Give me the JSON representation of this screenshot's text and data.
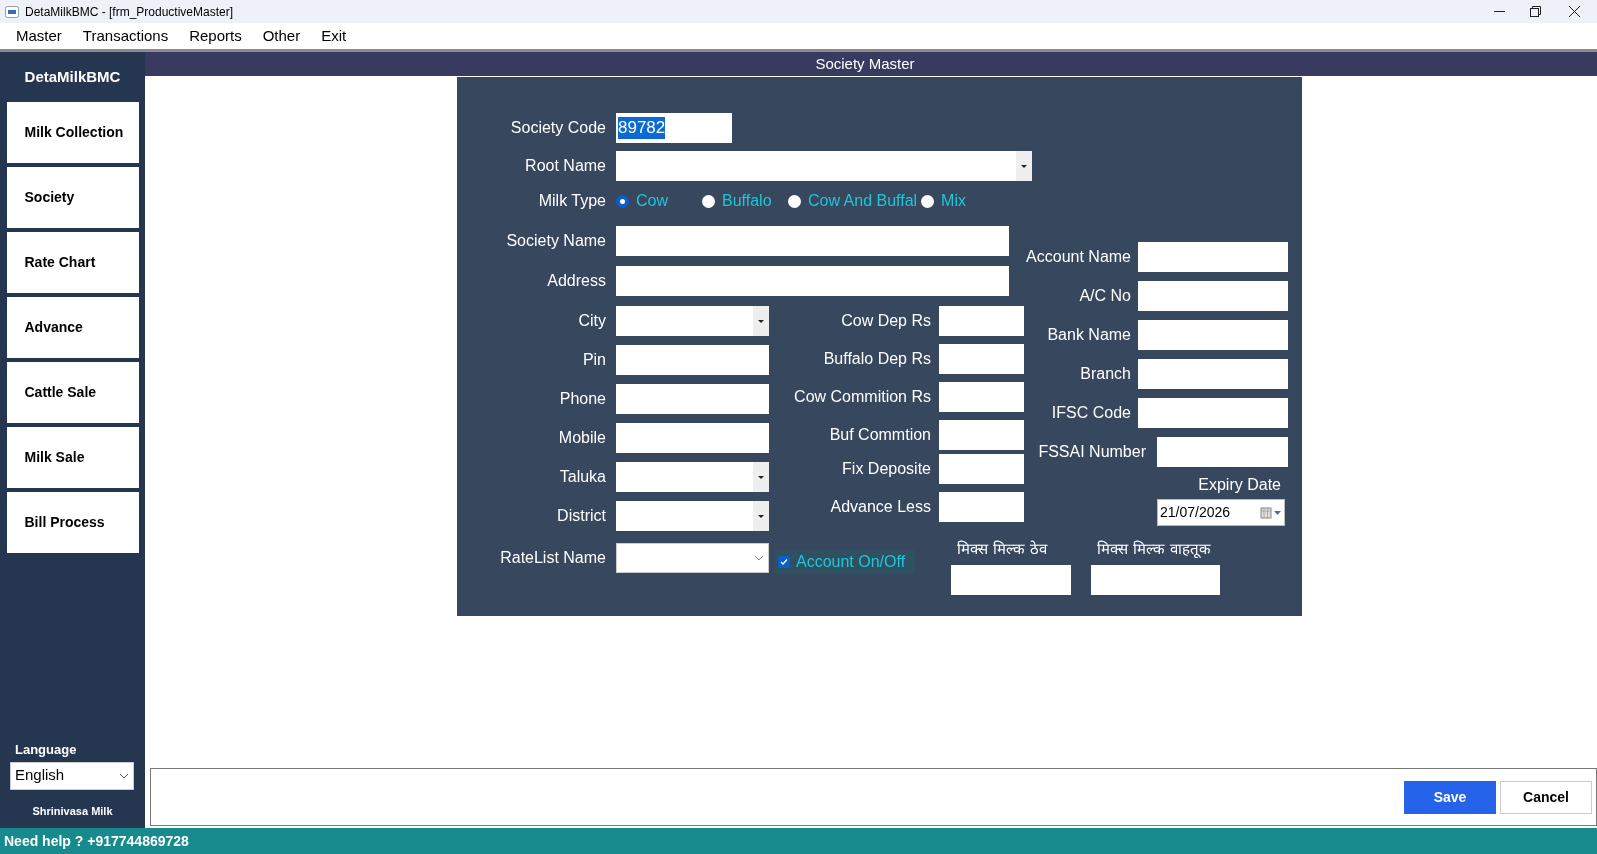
{
  "window": {
    "title": "DetaMilkBMC - [frm_ProductiveMaster]"
  },
  "menu": [
    "Master",
    "Transactions",
    "Reports",
    "Other",
    "Exit"
  ],
  "sidebar": {
    "brand": "DetaMilkBMC",
    "items": [
      "Milk Collection",
      "Society",
      "Rate Chart",
      "Advance",
      "Cattle Sale",
      "Milk Sale",
      "Bill Process"
    ],
    "language": {
      "label": "Language",
      "value": "English"
    },
    "footer": "Shrinivasa Milk"
  },
  "header": {
    "title": "Society Master"
  },
  "form": {
    "top_fields": [
      {
        "label": "Society Code",
        "kind": "text",
        "value": "89782",
        "highlighted": true
      },
      {
        "label": "Root Name",
        "kind": "dropdown"
      }
    ],
    "milk_type": {
      "label": "Milk Type",
      "options": [
        {
          "label": "Cow",
          "selected": true
        },
        {
          "label": "Buffalo",
          "selected": false
        },
        {
          "label": "Cow And Buffal",
          "selected": false
        },
        {
          "label": "Mix",
          "selected": false
        }
      ]
    },
    "wide_fields": [
      {
        "label": "Society Name",
        "kind": "text"
      },
      {
        "label": "Address",
        "kind": "text"
      }
    ],
    "left_fields": [
      {
        "label": "City",
        "kind": "dropdown"
      },
      {
        "label": "Pin",
        "kind": "text"
      },
      {
        "label": "Phone",
        "kind": "text"
      },
      {
        "label": "Mobile",
        "kind": "text"
      },
      {
        "label": "Taluka",
        "kind": "dropdown"
      },
      {
        "label": "District",
        "kind": "dropdown"
      }
    ],
    "middle_fields": [
      {
        "label": "Cow Dep Rs",
        "kind": "text"
      },
      {
        "label": "Buffalo Dep Rs",
        "kind": "text"
      },
      {
        "label": "Cow Commition Rs",
        "kind": "text"
      },
      {
        "label": "Buf Commtion",
        "kind": "text"
      },
      {
        "label": "Fix Deposite",
        "kind": "text"
      },
      {
        "label": "Advance Less",
        "kind": "text"
      }
    ],
    "bank_fields": [
      {
        "label": "Account Name",
        "kind": "text"
      },
      {
        "label": "A/C No",
        "kind": "text"
      },
      {
        "label": "Bank Name",
        "kind": "text"
      },
      {
        "label": "Branch",
        "kind": "text"
      },
      {
        "label": "IFSC Code",
        "kind": "text"
      },
      {
        "label": "FSSAI Number",
        "kind": "text"
      }
    ],
    "expiry": {
      "label": "Expiry Date",
      "value": "21/07/2026"
    },
    "ratelist": {
      "label": "RateList Name",
      "kind": "combo"
    },
    "account_toggle": {
      "label": "Account On/Off",
      "checked": true
    },
    "mix_fields": [
      {
        "label": "मिक्स मिल्क ठेव",
        "kind": "text"
      },
      {
        "label": "मिक्स मिल्क वाहतूक",
        "kind": "text"
      }
    ]
  },
  "buttons": [
    {
      "label": "Save",
      "kind": "primary"
    },
    {
      "label": "Cancel",
      "kind": "secondary"
    }
  ],
  "status_bar": "Need help ? +917744869728"
}
